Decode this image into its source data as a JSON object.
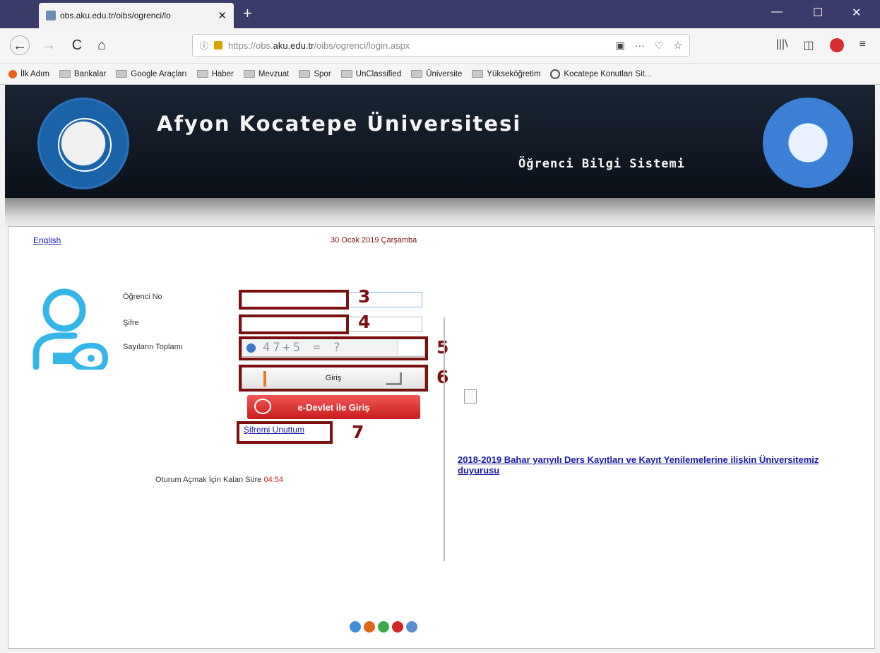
{
  "browser": {
    "tab_title": "obs.aku.edu.tr/oibs/ogrenci/lo",
    "tab_close": "✕",
    "new_tab": "+",
    "win_min": "—",
    "win_max": "☐",
    "win_close": "✕",
    "nav": {
      "back": "←",
      "forward": "→",
      "reload": "C",
      "home": "⌂"
    },
    "url_scheme": "https://obs.",
    "url_host": "aku.edu.tr",
    "url_path": "/oibs/ogrenci/login.aspx",
    "url_actions": {
      "reader": "▣",
      "more": "···",
      "pocket": "♡",
      "star": "☆"
    },
    "toolbar": {
      "library": "|||\\",
      "sidebar": "◫",
      "menu": "≡"
    }
  },
  "bookmarks": [
    {
      "label": "İlk Adım",
      "icon": "firefox-icon"
    },
    {
      "label": "Bankalar",
      "icon": "folder-icon"
    },
    {
      "label": "Google Araçları",
      "icon": "folder-icon"
    },
    {
      "label": "Haber",
      "icon": "folder-icon"
    },
    {
      "label": "Mevzuat",
      "icon": "folder-icon"
    },
    {
      "label": "Spor",
      "icon": "folder-icon"
    },
    {
      "label": "UnClassified",
      "icon": "folder-icon"
    },
    {
      "label": "Üniversite",
      "icon": "folder-icon"
    },
    {
      "label": "Yükseköğretim",
      "icon": "folder-icon"
    },
    {
      "label": "Kocatepe Konutları Sit...",
      "icon": "globe-icon"
    }
  ],
  "header": {
    "title": "Afyon Kocatepe Üniversitesi",
    "subtitle": "Öğrenci Bilgi Sistemi"
  },
  "page": {
    "language_link": "English",
    "date": "30 Ocak 2019 Çarşamba",
    "labels": {
      "student_no": "Öğrenci No",
      "password": "Şifre",
      "sum": "Sayıların Toplamı"
    },
    "captcha_text": "47+5 = ?",
    "login_button": "Giriş",
    "edevlet_button": "e-Devlet ile Giriş",
    "forgot_password": "Şifremi Unuttum",
    "session_label": "Oturum Açmak İçin Kalan Süre",
    "session_time": "04:54",
    "announcement": "2018-2019 Bahar yarıyılı Ders Kayıtları ve Kayıt Yenilemelerine ilişkin Üniversitemiz duyurusu"
  },
  "annotations": [
    "3",
    "4",
    "5",
    "6",
    "7"
  ],
  "colors": {
    "header_bg": "#0f1620",
    "annotation": "#7a1010",
    "link": "#1a1aa6",
    "edevlet": "#d82a2a"
  }
}
